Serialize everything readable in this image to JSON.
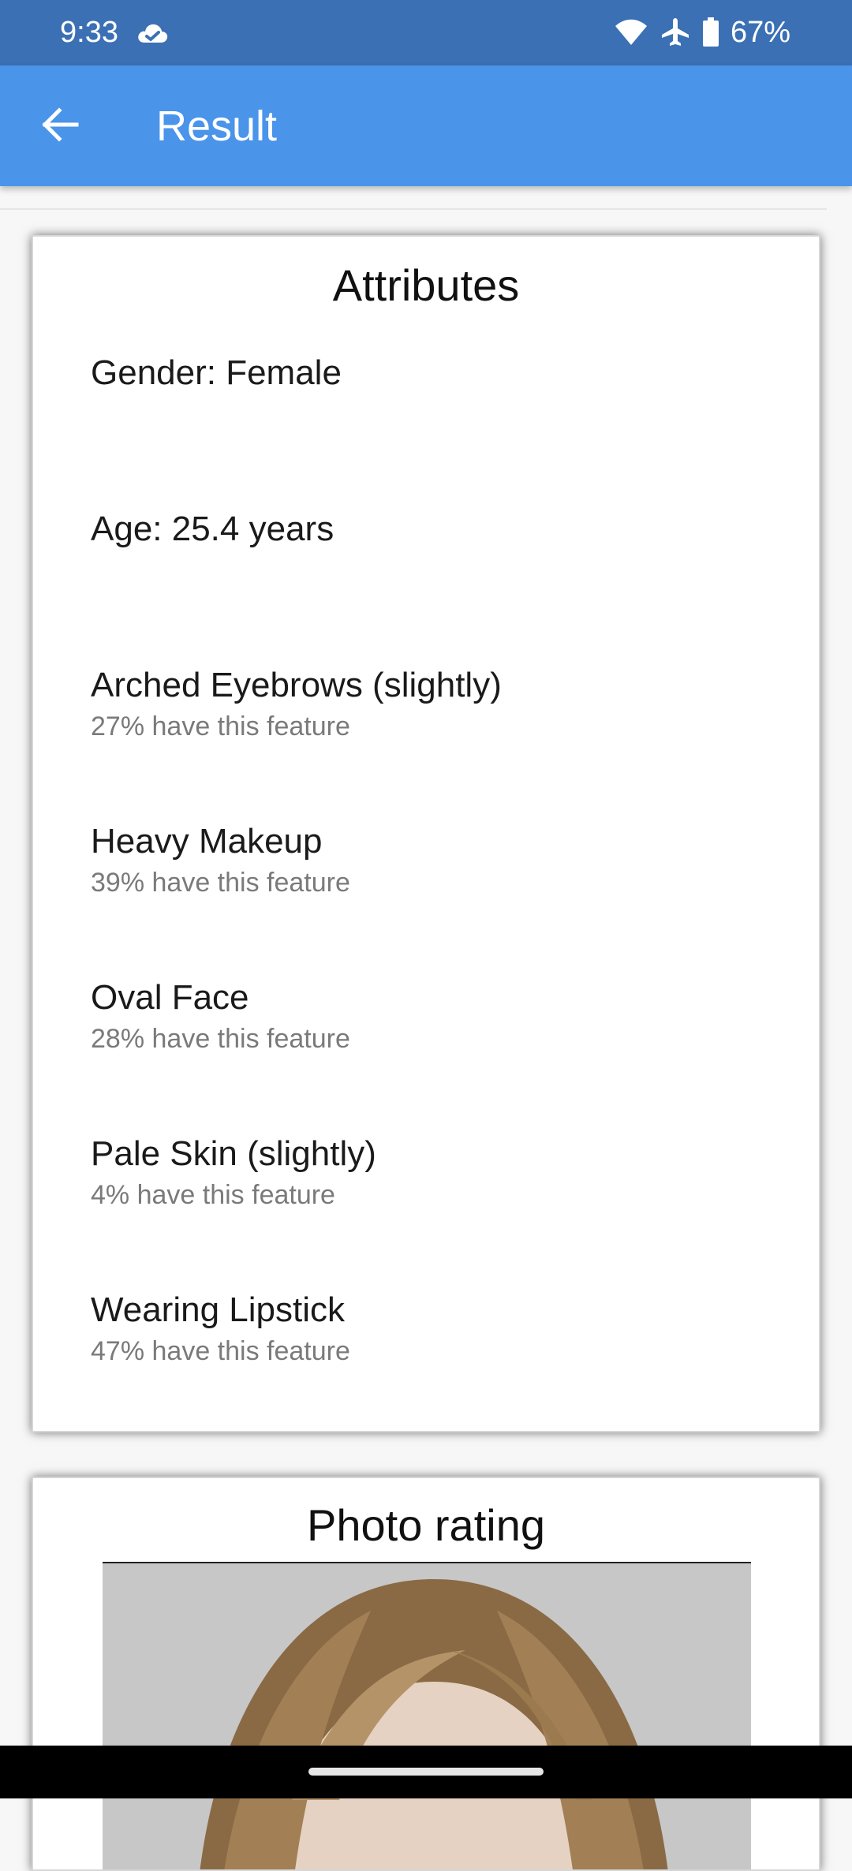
{
  "status_bar": {
    "time": "9:33",
    "battery": "67%",
    "icons": [
      "cloud-icon",
      "wifi-icon",
      "airplane-icon",
      "battery-icon"
    ]
  },
  "app_bar": {
    "title": "Result",
    "back_icon": "arrow-back-icon",
    "color": "#4a94ea"
  },
  "attributes_card": {
    "title": "Attributes",
    "gender": "Gender: Female",
    "age": "Age: 25.4 years",
    "features": [
      {
        "label": "Arched Eyebrows (slightly)",
        "stat": "27% have this feature"
      },
      {
        "label": "Heavy Makeup",
        "stat": "39% have this feature"
      },
      {
        "label": "Oval Face",
        "stat": "28% have this feature"
      },
      {
        "label": "Pale Skin (slightly)",
        "stat": "4% have this feature"
      },
      {
        "label": "Wearing Lipstick",
        "stat": "47% have this feature"
      }
    ]
  },
  "photo_card": {
    "title": "Photo rating"
  }
}
